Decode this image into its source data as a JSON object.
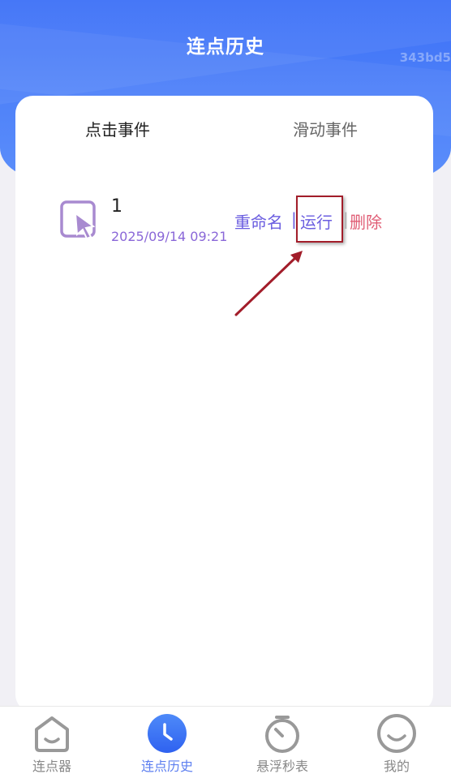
{
  "header": {
    "title": "连点历史",
    "watermark": "343bd5"
  },
  "tabs": {
    "active": "点击事件",
    "inactive": "滑动事件"
  },
  "records": [
    {
      "name": "1",
      "time": "2025/09/14 09:21",
      "actions": {
        "rename": "重命名",
        "separator": "|",
        "run": "运行",
        "separator2": "|",
        "delete": "删除"
      }
    }
  ],
  "bottom_nav": [
    {
      "label": "连点器",
      "icon": "home-smile-icon"
    },
    {
      "label": "连点历史",
      "icon": "clock-icon"
    },
    {
      "label": "悬浮秒表",
      "icon": "stopwatch-icon"
    },
    {
      "label": "我的",
      "icon": "smiley-icon"
    }
  ],
  "colors": {
    "primary": "#3b6ff7",
    "purple": "#8a67d8",
    "delete_red": "#e05d75",
    "annotation_red": "#a21d2a"
  }
}
